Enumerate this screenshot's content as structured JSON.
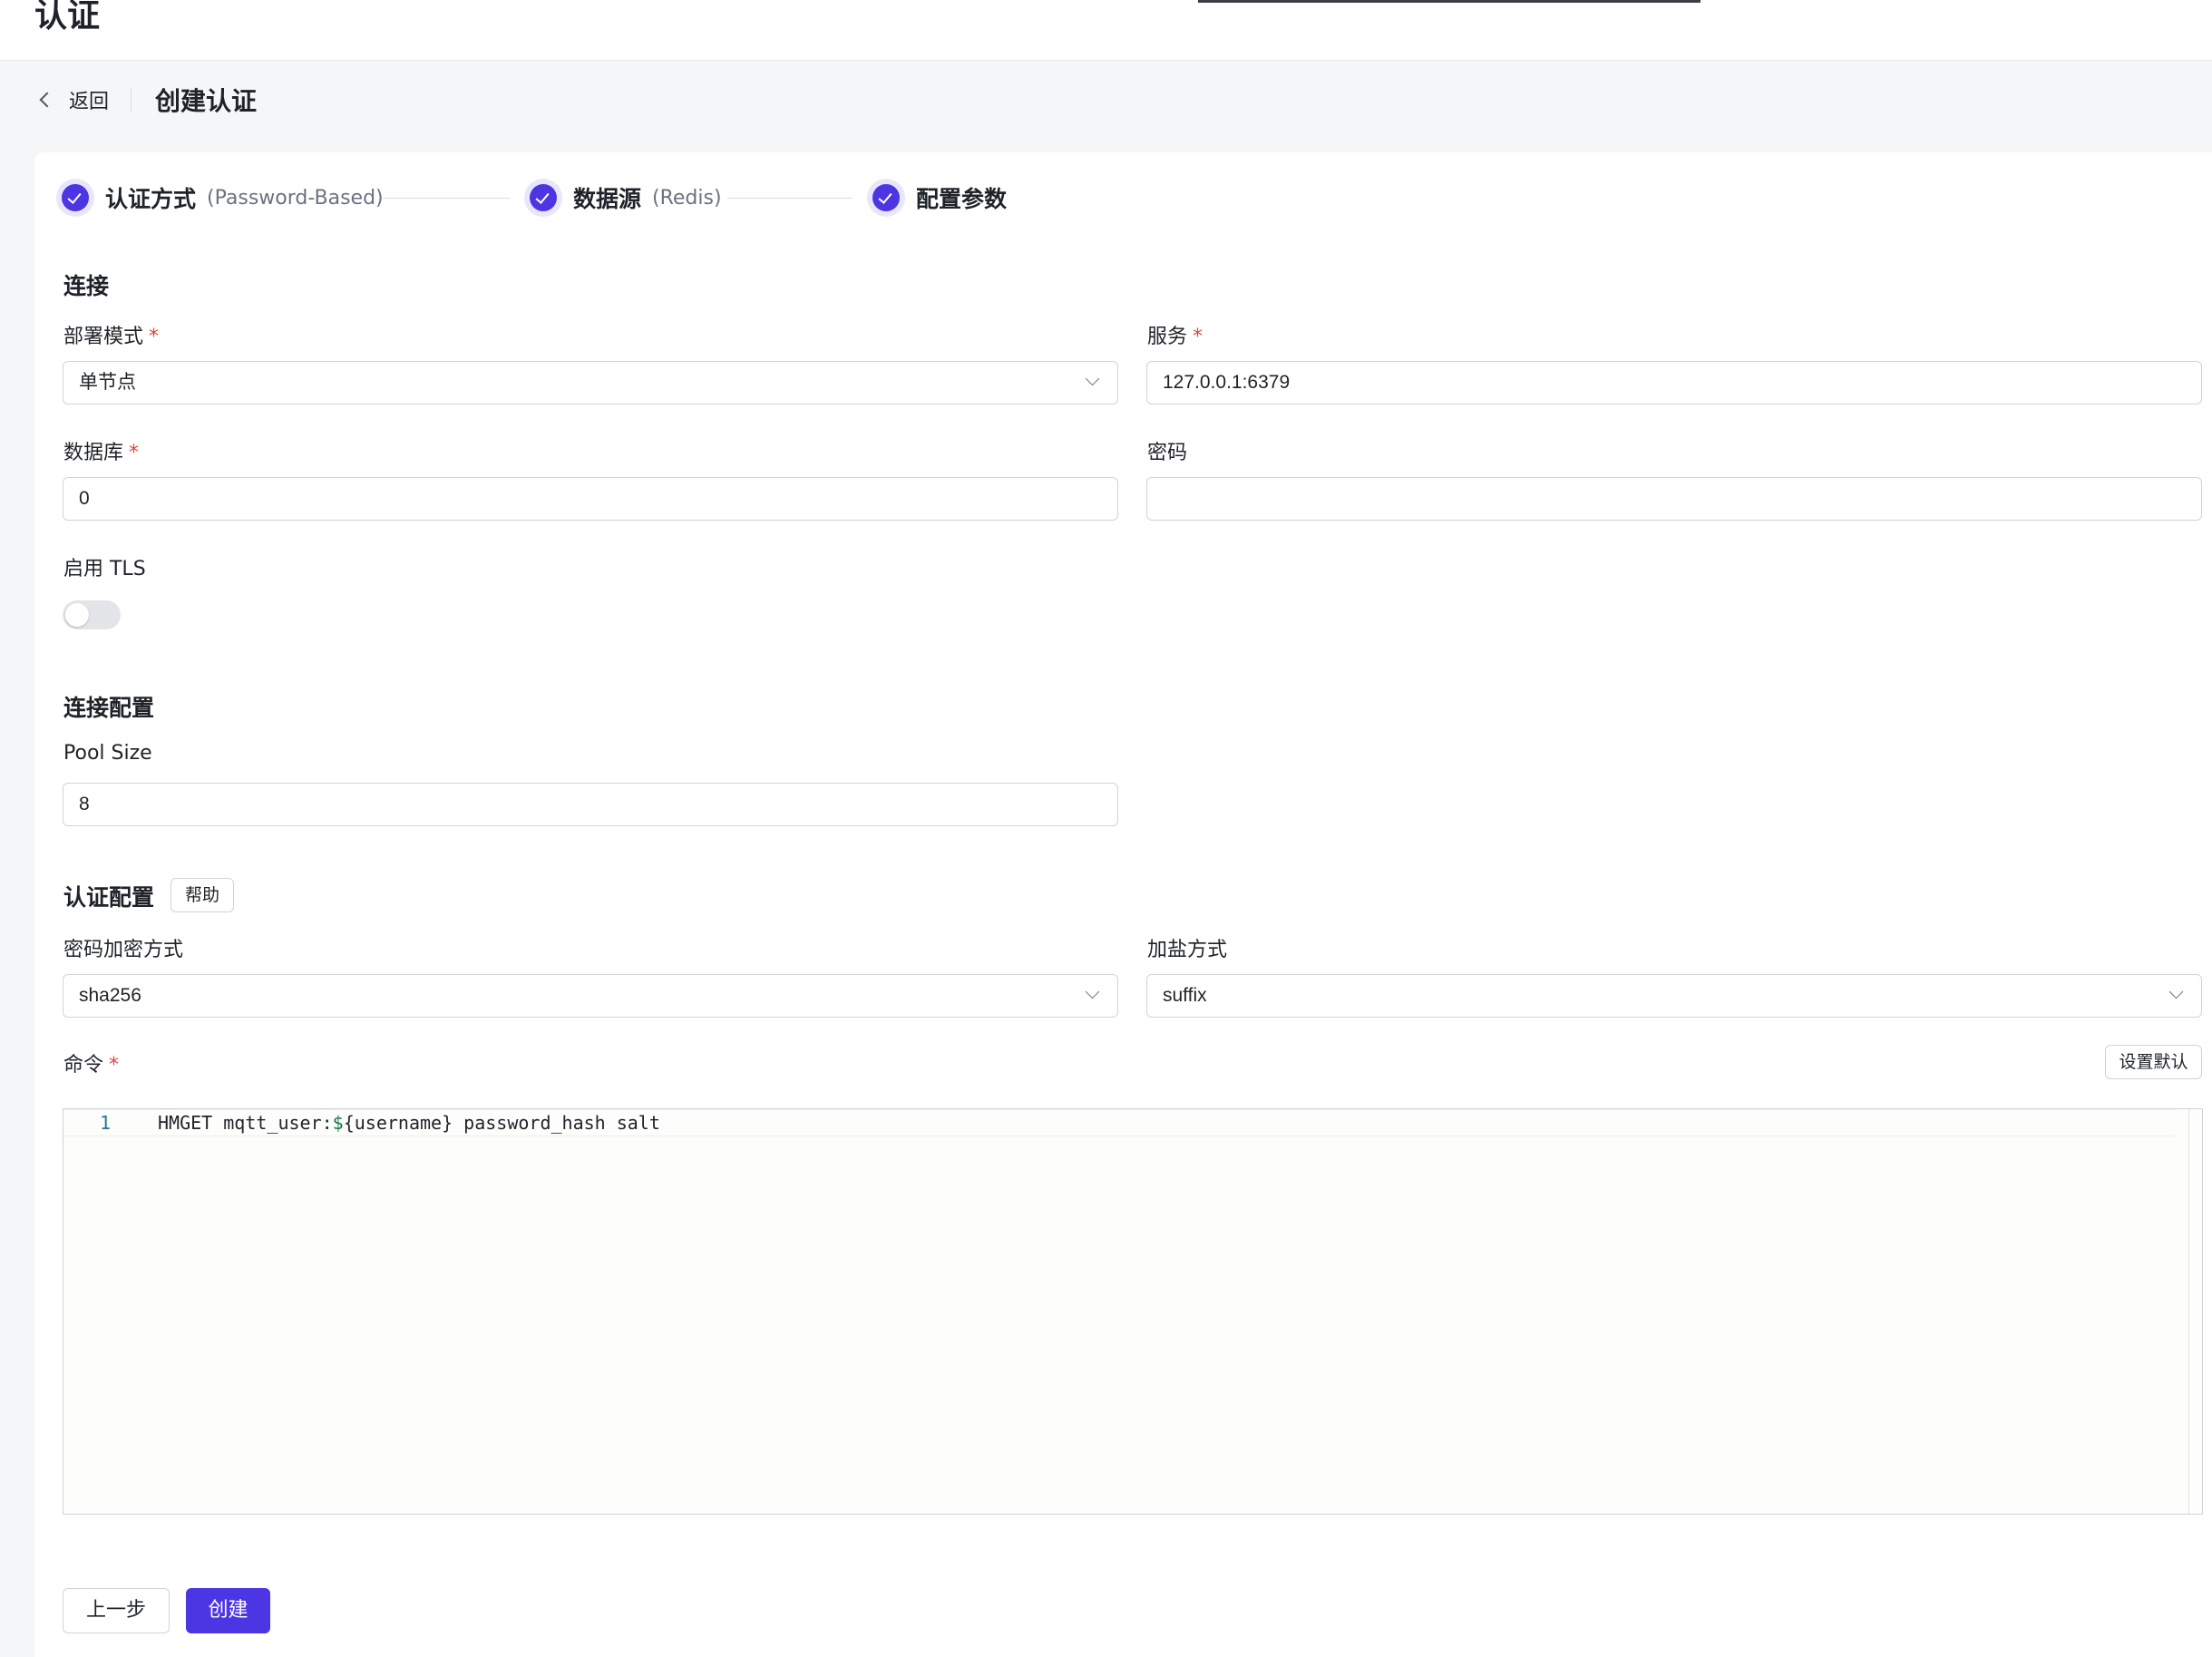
{
  "header": {
    "page_title": "认证"
  },
  "breadcrumb": {
    "back_label": "返回",
    "title": "创建认证"
  },
  "steps": [
    {
      "label": "认证方式",
      "sub": "(Password-Based)"
    },
    {
      "label": "数据源",
      "sub": "(Redis)"
    },
    {
      "label": "配置参数",
      "sub": ""
    }
  ],
  "connection": {
    "section_title": "连接",
    "deploy_mode": {
      "label": "部署模式",
      "required": "*",
      "value": "单节点"
    },
    "server": {
      "label": "服务",
      "required": "*",
      "value": "127.0.0.1:6379"
    },
    "database": {
      "label": "数据库",
      "required": "*",
      "value": "0"
    },
    "password": {
      "label": "密码",
      "value": ""
    },
    "tls": {
      "label": "启用 TLS",
      "enabled": false
    }
  },
  "connection_config": {
    "section_title": "连接配置",
    "pool_size": {
      "label": "Pool Size",
      "value": "8"
    }
  },
  "auth_config": {
    "section_title": "认证配置",
    "help_label": "帮助",
    "password_hash": {
      "label": "密码加密方式",
      "value": "sha256"
    },
    "salt_position": {
      "label": "加盐方式",
      "value": "suffix"
    },
    "command": {
      "label": "命令",
      "required": "*",
      "set_default_label": "设置默认",
      "line_number": "1",
      "code_before": "HMGET mqtt_user:",
      "code_dollar": "$",
      "code_after": "{username} password_hash salt"
    }
  },
  "footer": {
    "prev_label": "上一步",
    "create_label": "创建"
  },
  "colors": {
    "accent": "#4c35e2",
    "required": "#e0463d"
  }
}
